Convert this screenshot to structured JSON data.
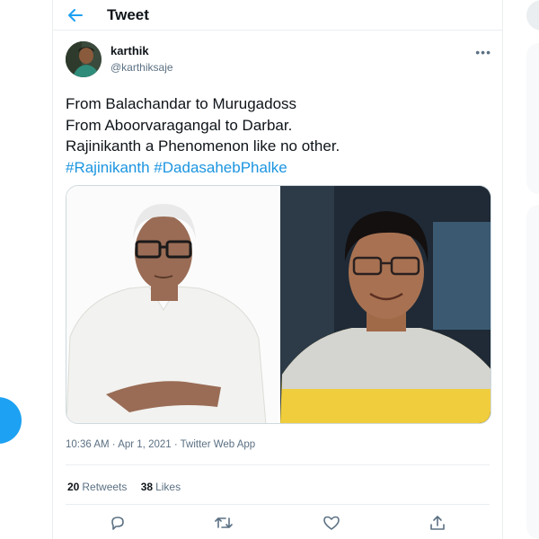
{
  "header": {
    "title": "Tweet"
  },
  "author": {
    "name": "karthik",
    "handle": "@karthiksaje"
  },
  "tweet": {
    "lines": [
      "From Balachandar to Murugadoss",
      "From Aboorvaragangal to Darbar.",
      "Rajinikanth a Phenomenon like no other."
    ],
    "hashtags": [
      "#Rajinikanth",
      "#DadasahebPhalke"
    ]
  },
  "meta": {
    "time": "10:36 AM",
    "sep": " · ",
    "date": "Apr 1, 2021",
    "source": "Twitter Web App"
  },
  "stats": {
    "retweets_count": "20",
    "retweets_label": "Retweets",
    "likes_count": "38",
    "likes_label": "Likes"
  },
  "colors": {
    "accent": "#1da1f2",
    "hashtag": "#1b95e0",
    "muted": "#5b7083"
  },
  "icons": {
    "back": "arrow-left-icon",
    "more": "more-horizontal-icon",
    "reply": "reply-icon",
    "retweet": "retweet-icon",
    "like": "heart-icon",
    "share": "share-icon"
  }
}
